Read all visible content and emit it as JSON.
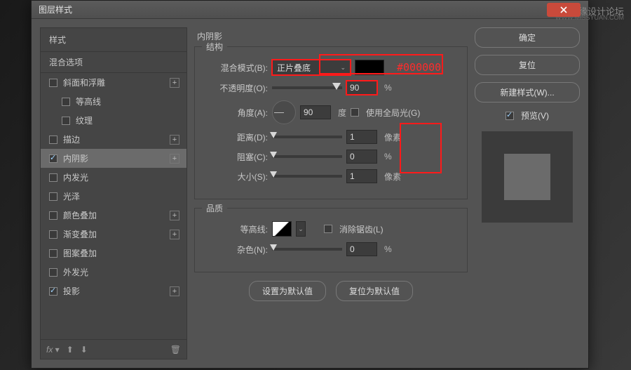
{
  "watermark": "思缘设计论坛",
  "watermark_url": "WWW.MISSYUAN.COM",
  "dialog_title": "图层样式",
  "sidebar": {
    "styles_header": "样式",
    "blend_options": "混合选项",
    "items": [
      {
        "label": "斜面和浮雕",
        "checked": false,
        "plus": true
      },
      {
        "label": "等高线",
        "checked": false,
        "sub": true
      },
      {
        "label": "纹理",
        "checked": false,
        "sub": true
      },
      {
        "label": "描边",
        "checked": false,
        "plus": true
      },
      {
        "label": "内阴影",
        "checked": true,
        "active": true,
        "plus": true
      },
      {
        "label": "内发光",
        "checked": false
      },
      {
        "label": "光泽",
        "checked": false
      },
      {
        "label": "颜色叠加",
        "checked": false,
        "plus": true
      },
      {
        "label": "渐变叠加",
        "checked": false,
        "plus": true
      },
      {
        "label": "图案叠加",
        "checked": false
      },
      {
        "label": "外发光",
        "checked": false
      },
      {
        "label": "投影",
        "checked": true,
        "plus": true
      }
    ],
    "fx_label": "fx"
  },
  "center": {
    "title": "内阴影",
    "structure_title": "结构",
    "blend_mode_label": "混合模式(B):",
    "blend_mode_value": "正片叠底",
    "color_annotation": "#000000",
    "opacity_label": "不透明度(O):",
    "opacity_value": "90",
    "percent": "%",
    "angle_label": "角度(A):",
    "angle_value": "90",
    "angle_unit": "度",
    "global_light_label": "使用全局光(G)",
    "distance_label": "距离(D):",
    "distance_value": "1",
    "px_unit": "像素",
    "choke_label": "阻塞(C):",
    "choke_value": "0",
    "size_label": "大小(S):",
    "size_value": "1",
    "quality_title": "品质",
    "contour_label": "等高线:",
    "antialias_label": "消除锯齿(L)",
    "noise_label": "杂色(N):",
    "noise_value": "0",
    "btn_default": "设置为默认值",
    "btn_reset": "复位为默认值"
  },
  "right": {
    "ok": "确定",
    "cancel": "复位",
    "new_style": "新建样式(W)...",
    "preview": "预览(V)"
  }
}
